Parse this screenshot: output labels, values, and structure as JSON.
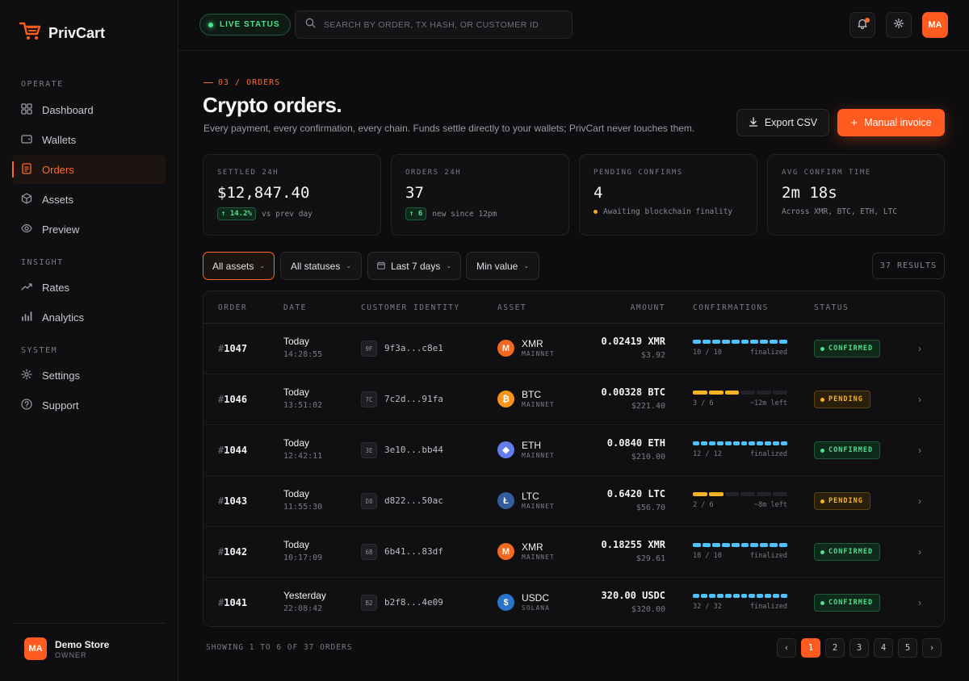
{
  "brand": {
    "name": "PrivCart"
  },
  "sidebar": {
    "sections": [
      {
        "title": "OPERATE",
        "items": [
          {
            "label": "Dashboard",
            "icon": "grid-icon"
          },
          {
            "label": "Wallets",
            "icon": "wallet-icon"
          },
          {
            "label": "Orders",
            "icon": "receipt-icon",
            "active": true
          },
          {
            "label": "Assets",
            "icon": "cube-icon"
          },
          {
            "label": "Preview",
            "icon": "eye-icon"
          }
        ]
      },
      {
        "title": "INSIGHT",
        "items": [
          {
            "label": "Rates",
            "icon": "trend-icon"
          },
          {
            "label": "Analytics",
            "icon": "bar-chart-icon"
          }
        ]
      },
      {
        "title": "SYSTEM",
        "items": [
          {
            "label": "Settings",
            "icon": "gear-icon"
          },
          {
            "label": "Support",
            "icon": "help-icon"
          }
        ]
      }
    ],
    "footer": {
      "avatar": "MA",
      "store_name": "Demo Store",
      "role": "OWNER"
    }
  },
  "topbar": {
    "live_label": "LIVE STATUS",
    "search_placeholder": "SEARCH BY ORDER, TX HASH, OR CUSTOMER ID",
    "avatar": "MA"
  },
  "header": {
    "breadcrumb": "03 / ORDERS",
    "title": "Crypto orders.",
    "subtitle": "Every payment, every confirmation, every chain. Funds settle directly to your wallets; PrivCart never touches them.",
    "export_label": "Export CSV",
    "invoice_label": "Manual invoice"
  },
  "stats": [
    {
      "label": "SETTLED 24H",
      "value": "$12,847.40",
      "delta": "14.2%",
      "note": "vs prev day"
    },
    {
      "label": "ORDERS 24H",
      "value": "37",
      "delta": "6",
      "note": "new since 12pm"
    },
    {
      "label": "PENDING CONFIRMS",
      "value": "4",
      "note": "Awaiting blockchain finality"
    },
    {
      "label": "AVG CONFIRM TIME",
      "value": "2m 18s",
      "note": "Across XMR, BTC, ETH, LTC"
    }
  ],
  "filters": {
    "assets": "All assets",
    "statuses": "All statuses",
    "range": "Last 7 days",
    "min_value": "Min value",
    "results": "37 RESULTS"
  },
  "table": {
    "headers": [
      "ORDER",
      "DATE",
      "CUSTOMER IDENTITY",
      "ASSET",
      "AMOUNT",
      "CONFIRMATIONS",
      "STATUS"
    ],
    "rows": [
      {
        "id": "1047",
        "day": "Today",
        "time": "14:28:55",
        "chip": "9F",
        "customer": "9f3a...c8e1",
        "asset": "XMR",
        "network": "MAINNET",
        "coin_color": "#f26822",
        "coin_glyph": "M",
        "amount": "0.02419 XMR",
        "fiat": "$3.92",
        "conf_done": 10,
        "conf_total": 10,
        "conf_text": "10 / 10",
        "conf_note": "finalized",
        "status": "CONFIRMED"
      },
      {
        "id": "1046",
        "day": "Today",
        "time": "13:51:02",
        "chip": "7C",
        "customer": "7c2d...91fa",
        "asset": "BTC",
        "network": "MAINNET",
        "coin_color": "#f7931a",
        "coin_glyph": "₿",
        "amount": "0.00328 BTC",
        "fiat": "$221.40",
        "conf_done": 3,
        "conf_total": 6,
        "conf_text": "3 / 6",
        "conf_note": "~12m left",
        "status": "PENDING"
      },
      {
        "id": "1044",
        "day": "Today",
        "time": "12:42:11",
        "chip": "3E",
        "customer": "3e10...bb44",
        "asset": "ETH",
        "network": "MAINNET",
        "coin_color": "#627eea",
        "coin_glyph": "◆",
        "amount": "0.0840 ETH",
        "fiat": "$210.00",
        "conf_done": 12,
        "conf_total": 12,
        "conf_text": "12 / 12",
        "conf_note": "finalized",
        "status": "CONFIRMED"
      },
      {
        "id": "1043",
        "day": "Today",
        "time": "11:55:30",
        "chip": "D8",
        "customer": "d822...50ac",
        "asset": "LTC",
        "network": "MAINNET",
        "coin_color": "#345d9d",
        "coin_glyph": "Ł",
        "amount": "0.6420 LTC",
        "fiat": "$56.70",
        "conf_done": 2,
        "conf_total": 6,
        "conf_text": "2 / 6",
        "conf_note": "~8m left",
        "status": "PENDING"
      },
      {
        "id": "1042",
        "day": "Today",
        "time": "10:17:09",
        "chip": "6B",
        "customer": "6b41...83df",
        "asset": "XMR",
        "network": "MAINNET",
        "coin_color": "#f26822",
        "coin_glyph": "M",
        "amount": "0.18255 XMR",
        "fiat": "$29.61",
        "conf_done": 10,
        "conf_total": 10,
        "conf_text": "10 / 10",
        "conf_note": "finalized",
        "status": "CONFIRMED"
      },
      {
        "id": "1041",
        "day": "Yesterday",
        "time": "22:08:42",
        "chip": "B2",
        "customer": "b2f8...4e09",
        "asset": "USDC",
        "network": "SOLANA",
        "coin_color": "#2775ca",
        "coin_glyph": "$",
        "amount": "320.00 USDC",
        "fiat": "$320.00",
        "conf_done": 32,
        "conf_total": 32,
        "conf_text": "32 / 32",
        "conf_note": "finalized",
        "status": "CONFIRMED"
      }
    ]
  },
  "pagination": {
    "showing": "SHOWING 1 TO 6 OF 37 ORDERS",
    "pages": [
      "1",
      "2",
      "3",
      "4",
      "5"
    ],
    "current": "1"
  },
  "colors": {
    "accent": "#ff5a1f",
    "confirmed": "#4ee08a",
    "pending": "#f5b323",
    "conf_bar": "#4fc3ff"
  }
}
